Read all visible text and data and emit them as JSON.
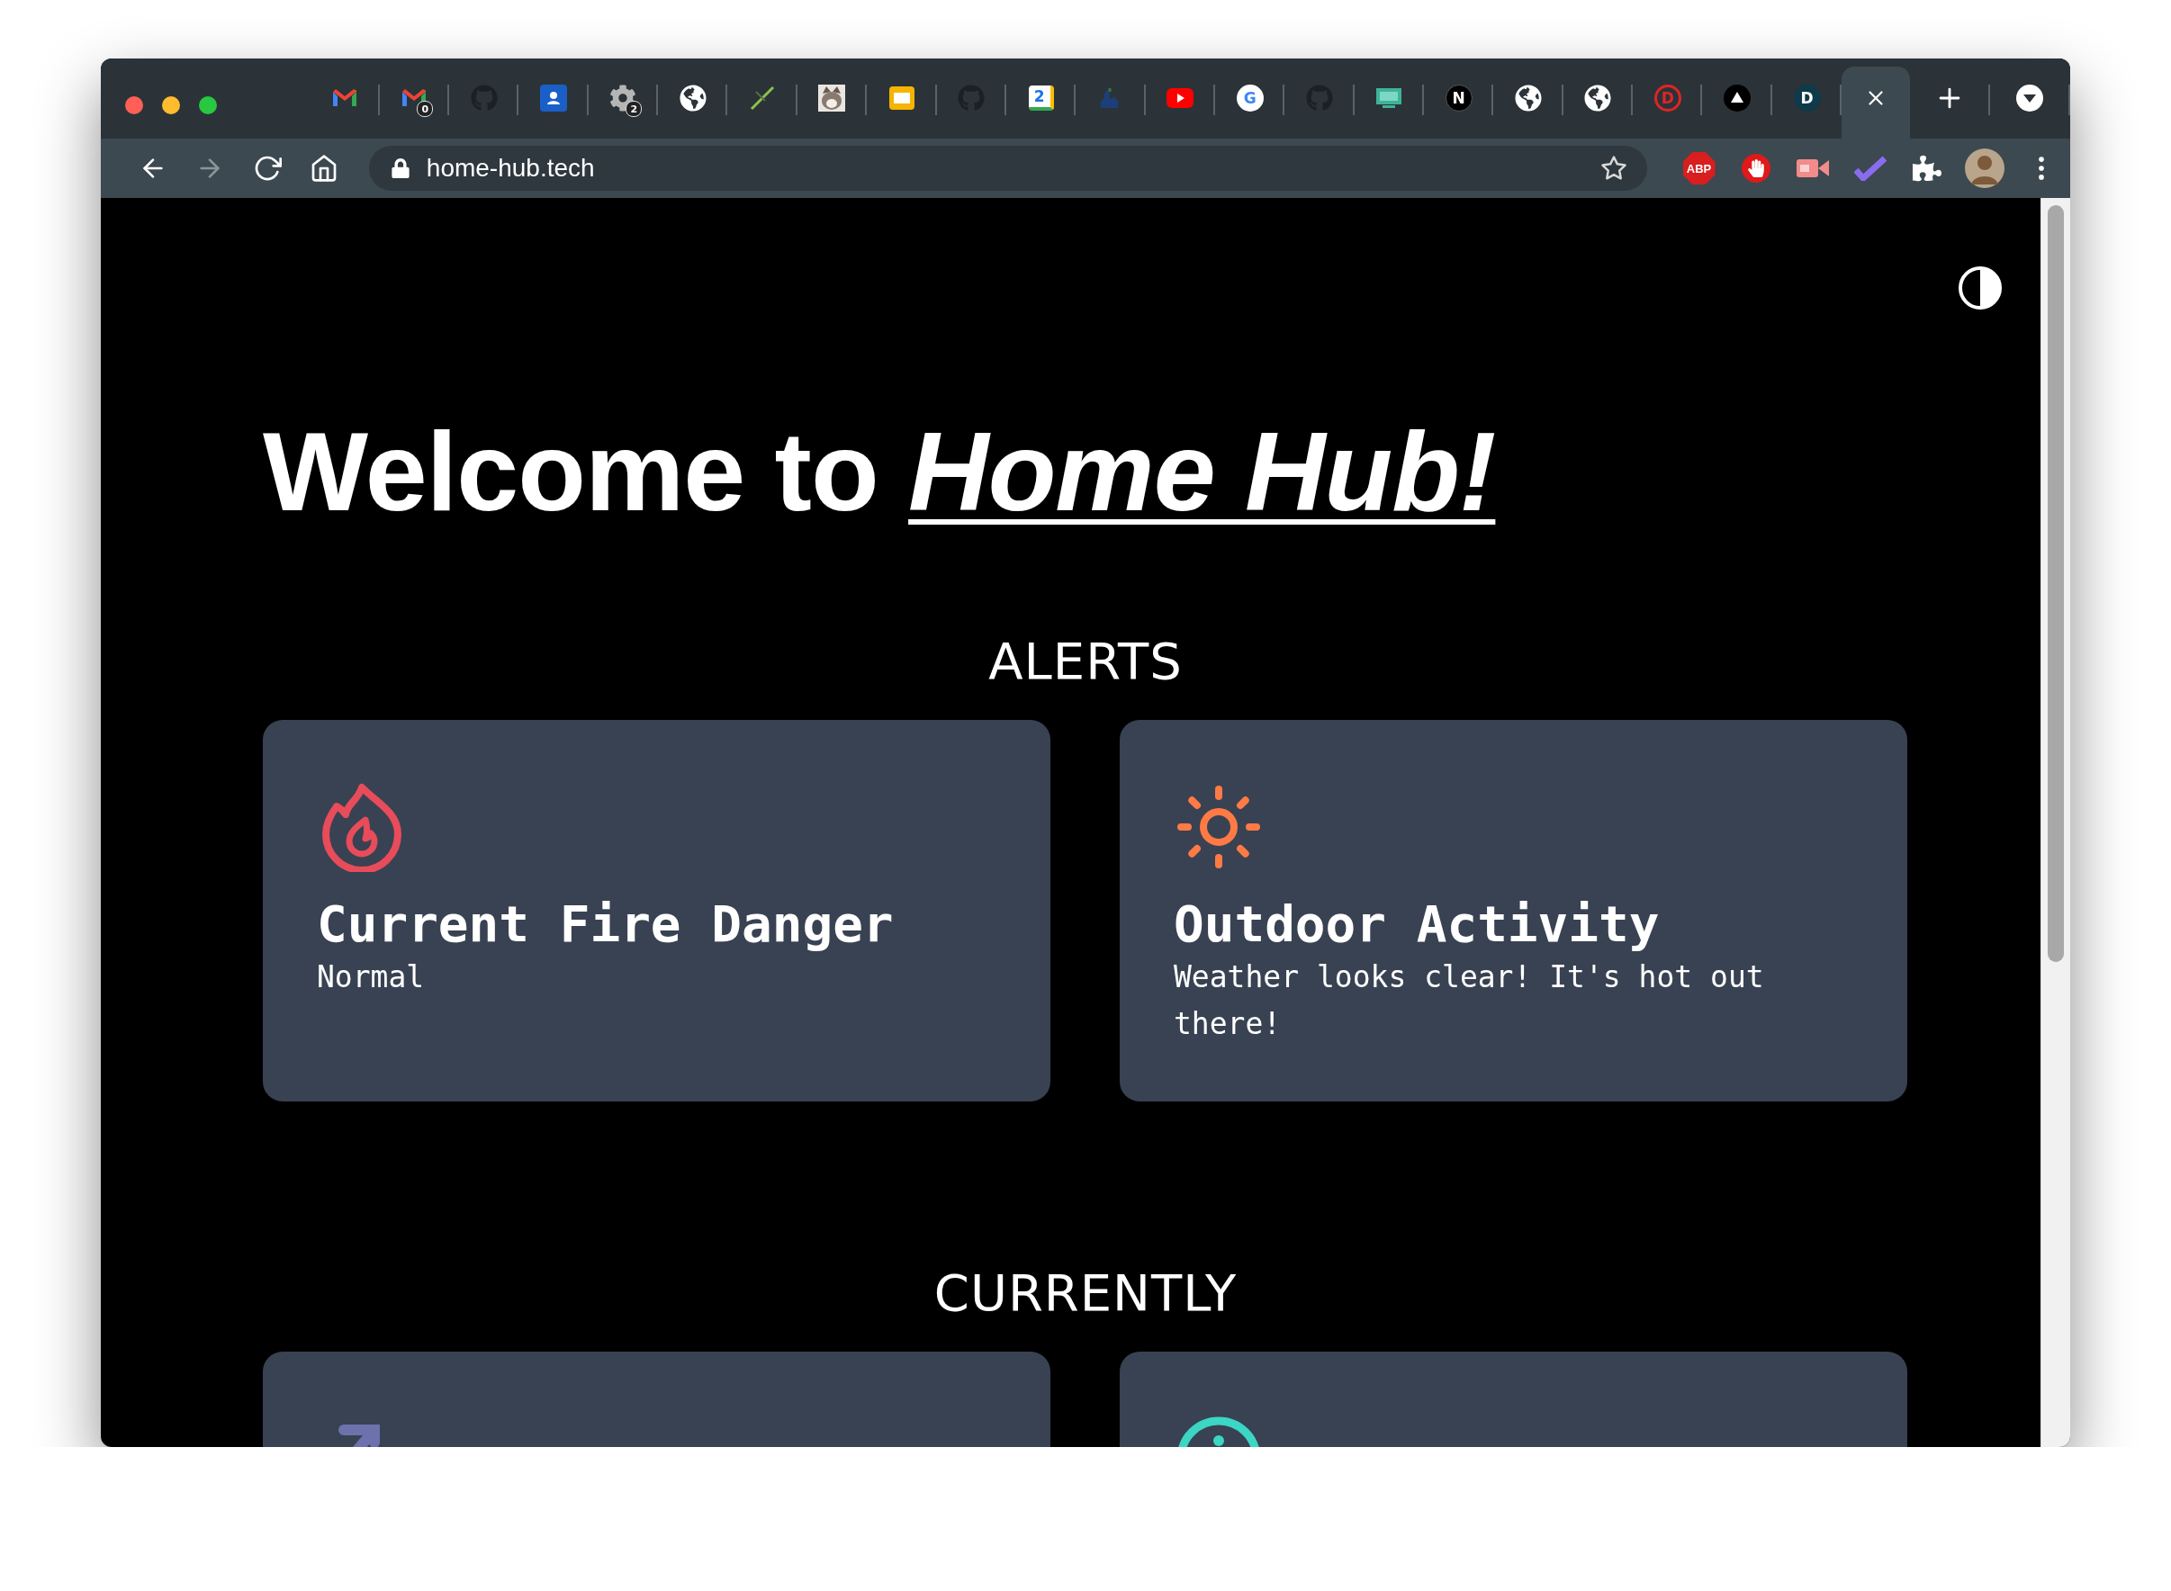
{
  "browser": {
    "tabs": [
      {
        "kind": "gmail",
        "selected": false
      },
      {
        "kind": "gmail",
        "badge": "0",
        "selected": false
      },
      {
        "kind": "github",
        "selected": false
      },
      {
        "kind": "contacts",
        "selected": false
      },
      {
        "kind": "gear",
        "badge": "2",
        "selected": false
      },
      {
        "kind": "globe",
        "selected": false
      },
      {
        "kind": "slash",
        "selected": false
      },
      {
        "kind": "picture",
        "selected": false
      },
      {
        "kind": "slides",
        "selected": false
      },
      {
        "kind": "github",
        "selected": false
      },
      {
        "kind": "calendar",
        "glyph": "2",
        "selected": false
      },
      {
        "kind": "logo",
        "selected": false
      },
      {
        "kind": "youtube",
        "selected": false
      },
      {
        "kind": "google",
        "glyph": "G",
        "selected": false
      },
      {
        "kind": "github",
        "selected": false
      },
      {
        "kind": "screen",
        "selected": false
      },
      {
        "kind": "dark-letter",
        "glyph": "N",
        "selected": false
      },
      {
        "kind": "globe",
        "selected": false
      },
      {
        "kind": "globe",
        "selected": false
      },
      {
        "kind": "ring-letter",
        "glyph": "D",
        "selected": false
      },
      {
        "kind": "triangle",
        "selected": false
      },
      {
        "kind": "teal-letter",
        "glyph": "D",
        "selected": false
      },
      {
        "kind": "blank",
        "selected": true
      }
    ],
    "address": "home-hub.tech",
    "extensions": [
      {
        "kind": "abp",
        "glyph": "ABP"
      },
      {
        "kind": "hand"
      },
      {
        "kind": "camera"
      },
      {
        "kind": "check"
      },
      {
        "kind": "puzzle"
      },
      {
        "kind": "avatar"
      }
    ]
  },
  "page": {
    "heading": "Welcome to ",
    "heading_emphasis": "Home Hub!",
    "sections": [
      {
        "title": "ALERTS",
        "cards": [
          {
            "kind": "fire",
            "title": "Current Fire Danger",
            "body": "Normal"
          },
          {
            "kind": "sun",
            "title": "Outdoor Activity",
            "body": "Weather looks clear! It's hot out there!"
          }
        ]
      },
      {
        "title": "CURRENTLY",
        "cards": [
          {
            "kind": "trend"
          },
          {
            "kind": "gauge"
          }
        ]
      }
    ]
  }
}
